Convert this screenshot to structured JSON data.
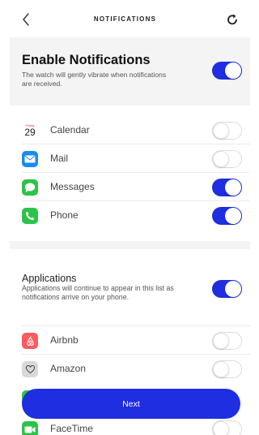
{
  "header": {
    "title": "NOTIFICATIONS",
    "back_icon": "chevron-left-icon",
    "refresh_icon": "refresh-icon"
  },
  "enable": {
    "title": "Enable Notifications",
    "subtitle": "The watch will gently vibrate when notifications are received.",
    "enabled": true
  },
  "core_apps": [
    {
      "label": "Calendar",
      "icon": "calendar-icon",
      "calendar_day": "29",
      "enabled": false
    },
    {
      "label": "Mail",
      "icon": "mail-icon",
      "enabled": false
    },
    {
      "label": "Messages",
      "icon": "messages-icon",
      "enabled": true
    },
    {
      "label": "Phone",
      "icon": "phone-icon",
      "enabled": true
    }
  ],
  "applications": {
    "title": "Applications",
    "subtitle": "Applications will continue to appear in this list as notifications arrive on your phone.",
    "enabled": true,
    "items": [
      {
        "label": "Airbnb",
        "icon": "airbnb-icon",
        "enabled": false
      },
      {
        "label": "Amazon",
        "icon": "amazon-icon",
        "enabled": false
      },
      {
        "label": "FaceTime",
        "icon": "facetime-icon",
        "enabled": false
      }
    ]
  },
  "next_button": {
    "label": "Next"
  },
  "colors": {
    "accent": "#1e2ee0",
    "section_bg": "#f4f4f4",
    "mail_blue": "#1a8cf0",
    "messages_green": "#2cc34a",
    "phone_green": "#2cc34a",
    "airbnb_red": "#ff5a5f",
    "calendar_red": "#e0352b"
  }
}
